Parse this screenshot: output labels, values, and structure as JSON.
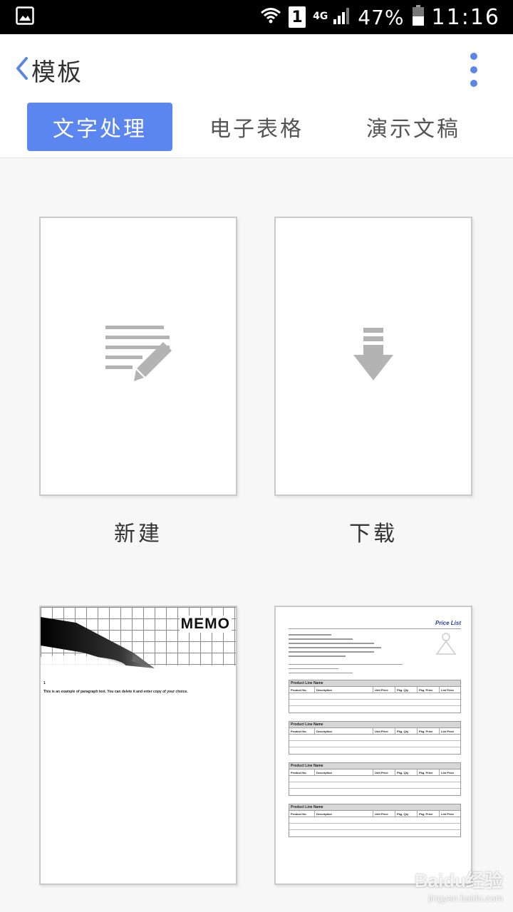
{
  "status_bar": {
    "net_type": "4G",
    "sim_slot": "1",
    "battery": "47%",
    "time": "11:16",
    "icons": [
      "gallery-icon",
      "wifi-icon",
      "signal-icon",
      "battery-icon"
    ]
  },
  "header": {
    "title": "模板",
    "back_icon": "chevron-left-icon",
    "menu_icon": "more-vert-icon"
  },
  "tabs": [
    {
      "label": "文字处理",
      "active": true
    },
    {
      "label": "电子表格",
      "active": false
    },
    {
      "label": "演示文稿",
      "active": false
    }
  ],
  "cards": [
    {
      "label": "新建",
      "icon": "document-edit-icon"
    },
    {
      "label": "下载",
      "icon": "download-arrow-icon"
    },
    {
      "label": "",
      "thumbnail": "memo",
      "memo_title": "MEMO",
      "memo_body": "This is an example of paragraph text. You can delete it and enter copy of your choice."
    },
    {
      "label": "",
      "thumbnail": "price-list",
      "price_title": "Price List",
      "section_title": "Product Line Name",
      "columns": [
        "Product No.",
        "Description",
        "Unit Price",
        "Pkg. Qty",
        "Pkg. Price",
        "List Price"
      ]
    }
  ],
  "watermark": {
    "main": "Baidu经验",
    "sub": "jingyan.baidu.com"
  },
  "colors": {
    "accent": "#5b86f0",
    "icon_gray": "#b3b3b3",
    "card_border": "#c9c9c9"
  }
}
